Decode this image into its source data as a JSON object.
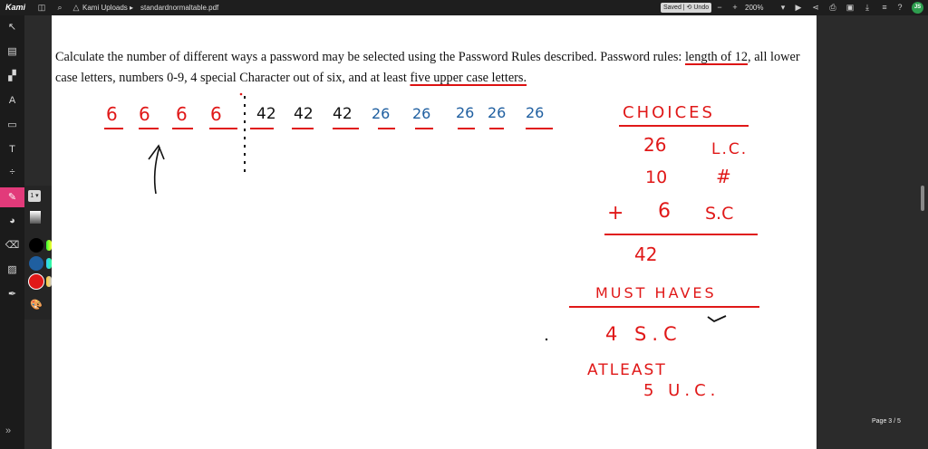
{
  "topbar": {
    "app_logo": "Kami",
    "breadcrumb_folder": "Kami Uploads",
    "breadcrumb_sep": "▸",
    "file_name": "standardnormaltable.pdf",
    "saved_label": "Saved | ⟲ Undo",
    "zoom": "200%",
    "avatar_initials": "JS"
  },
  "palette": {
    "size_label": "1 ▾",
    "colors": [
      "#000000",
      "#1f5fa0",
      "#e01818"
    ]
  },
  "question": {
    "part1": "Calculate the number of different ways a password may be selected using the Password Rules described. Password rules: ",
    "length_text": "length of 12",
    "part2": ", all lower case letters, numbers 0-9, 4 special Character out of six, and at least ",
    "upper_text": "five upper case letters."
  },
  "handwriting": {
    "slots_special": [
      "6",
      "6",
      "6",
      "6"
    ],
    "slots_any": [
      "42",
      "42",
      "42"
    ],
    "slots_upper": [
      "26",
      "26",
      "26",
      "26",
      "26"
    ],
    "choices_title": "CHOICES",
    "row1_num": "26",
    "row1_label": "L.C.",
    "row2_num": "10",
    "row2_label": "#",
    "row3_plus": "+",
    "row3_num": "6",
    "row3_label": "S.C",
    "total": "42",
    "must_haves_title": "MUST HAVES",
    "must_item": "4 S.C",
    "atleast_title": "ATLEAST",
    "atleast_item": "5 U.C."
  },
  "page_indicator": "Page   3   / 5",
  "colors": {
    "ink_red": "#e01818",
    "ink_blue": "#1f5fa0",
    "ink_black": "#111111",
    "accent": "#e23a7a"
  }
}
